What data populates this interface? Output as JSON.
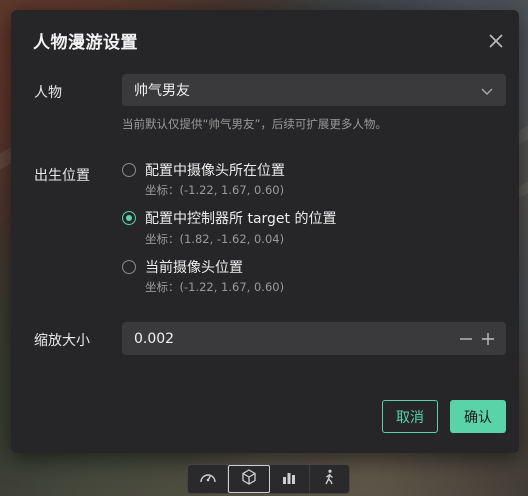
{
  "dialog": {
    "title": "人物漫游设置",
    "character": {
      "label": "人物",
      "selected": "帅气男友",
      "hint": "当前默认仅提供“帅气男友”，后续可扩展更多人物。"
    },
    "spawn": {
      "label": "出生位置",
      "options": [
        {
          "label": "配置中摄像头所在位置",
          "coord": "坐标：(-1.22, 1.67, 0.60)",
          "checked": false
        },
        {
          "label": "配置中控制器所 target 的位置",
          "coord": "坐标：(1.82, -1.62, 0.04)",
          "checked": true
        },
        {
          "label": "当前摄像头位置",
          "coord": "坐标：(-1.22, 1.67, 0.60)",
          "checked": false
        }
      ]
    },
    "scale": {
      "label": "缩放大小",
      "value": "0.002"
    },
    "buttons": {
      "cancel": "取消",
      "ok": "确认"
    }
  },
  "toolbar": {
    "tools": [
      "dashboard-icon",
      "cube-icon",
      "bar-chart-icon",
      "walk-icon"
    ],
    "active_index": 1
  },
  "colors": {
    "accent": "#5ad3a8",
    "dialog_bg": "#262628",
    "input_bg": "#3a3a3c"
  }
}
